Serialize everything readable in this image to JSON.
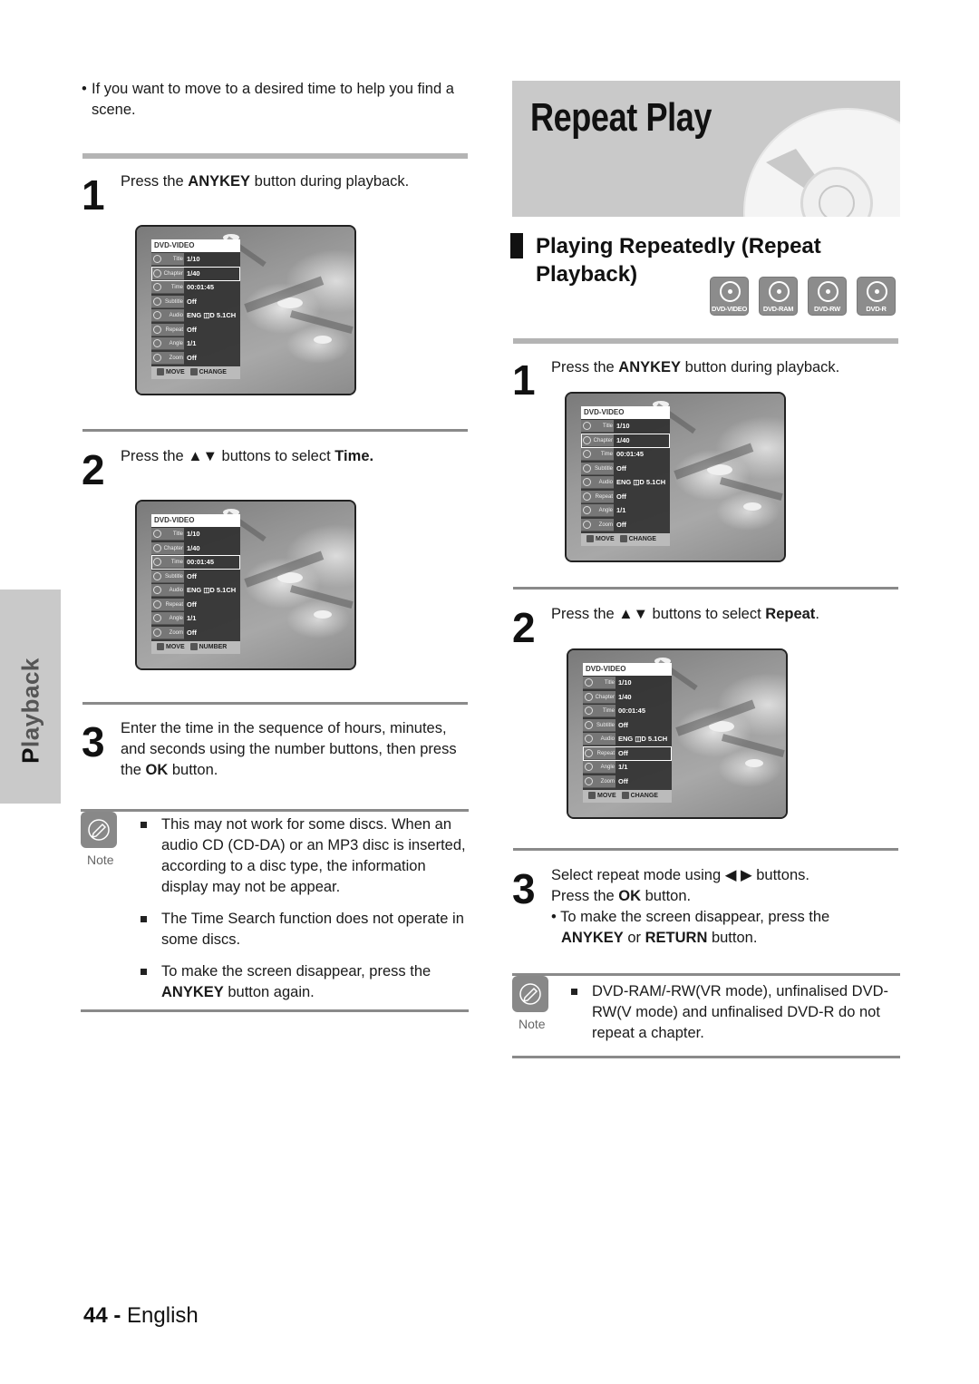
{
  "side_tab": {
    "label": "Playback"
  },
  "left": {
    "intro_bullet": "If you want to move to a desired time to help you find a scene.",
    "steps": [
      {
        "num": "1",
        "text_pre": "Press the ",
        "text_bold": "ANYKEY",
        "text_post": " button during playback."
      },
      {
        "num": "2",
        "text_pre": "Press the ▲▼ buttons to select ",
        "text_bold": "Time.",
        "text_post": ""
      },
      {
        "num": "3",
        "text_pre": "Enter the time in the sequence of hours, minutes, and seconds using the number buttons, then press the ",
        "text_bold": "OK",
        "text_post": " button."
      }
    ],
    "note": {
      "label": "Note",
      "items": [
        {
          "text": "This may not work for some discs. When an audio CD (CD-DA) or an MP3 disc is inserted, according to a disc type, the information display may not be appear.",
          "bold": "",
          "post": ""
        },
        {
          "text": "The Time Search function does not operate in some discs.",
          "bold": "",
          "post": ""
        },
        {
          "text": "To make the screen disappear, press the ",
          "bold": "ANYKEY",
          "post": " button again."
        }
      ]
    }
  },
  "right": {
    "banner_title": "Repeat Play",
    "section_title": "Playing Repeatedly (Repeat Playback)",
    "disc_badges": [
      "DVD-VIDEO",
      "DVD-RAM",
      "DVD-RW",
      "DVD-R"
    ],
    "steps": [
      {
        "num": "1",
        "text_pre": "Press the ",
        "text_bold": "ANYKEY",
        "text_post": " button during playback."
      },
      {
        "num": "2",
        "text_pre": "Press the ▲▼ buttons to select ",
        "text_bold": "Repeat",
        "text_post": "."
      },
      {
        "num": "3",
        "line1": "Select repeat mode using ◀ ▶ buttons.",
        "line2_pre": "Press the ",
        "line2_bold": "OK",
        "line2_post": " button.",
        "sub_pre": "• To make the screen disappear, press the ",
        "sub_bold1": "ANYKEY",
        "sub_mid": " or ",
        "sub_bold2": "RETURN",
        "sub_post": " button."
      }
    ],
    "note": {
      "label": "Note",
      "items": [
        {
          "text": "DVD-RAM/-RW(VR mode), unfinalised DVD-RW(V mode) and unfinalised DVD-R do not repeat a chapter."
        }
      ]
    }
  },
  "osd": {
    "header": "DVD-VIDEO",
    "rows": [
      {
        "label": "Title",
        "value": "1/10"
      },
      {
        "label": "Chapter",
        "value": "1/40"
      },
      {
        "label": "Time",
        "value": "00:01:45"
      },
      {
        "label": "Subtitle",
        "value": "Off"
      },
      {
        "label": "Audio",
        "value": "ENG ◫D 5.1CH"
      },
      {
        "label": "Repeat",
        "value": "Off"
      },
      {
        "label": "Angle",
        "value": "1/1"
      },
      {
        "label": "Zoom",
        "value": "Off"
      }
    ],
    "move_label": "MOVE",
    "change_label": "CHANGE",
    "number_label": "NUMBER",
    "screens": [
      {
        "selected": "Chapter",
        "action": "CHANGE"
      },
      {
        "selected": "Time",
        "action": "NUMBER"
      },
      {
        "selected": "Chapter",
        "action": "CHANGE"
      },
      {
        "selected": "Repeat",
        "action": "CHANGE"
      }
    ]
  },
  "footer": {
    "page_number": "44",
    "separator": " - ",
    "language": "English"
  }
}
